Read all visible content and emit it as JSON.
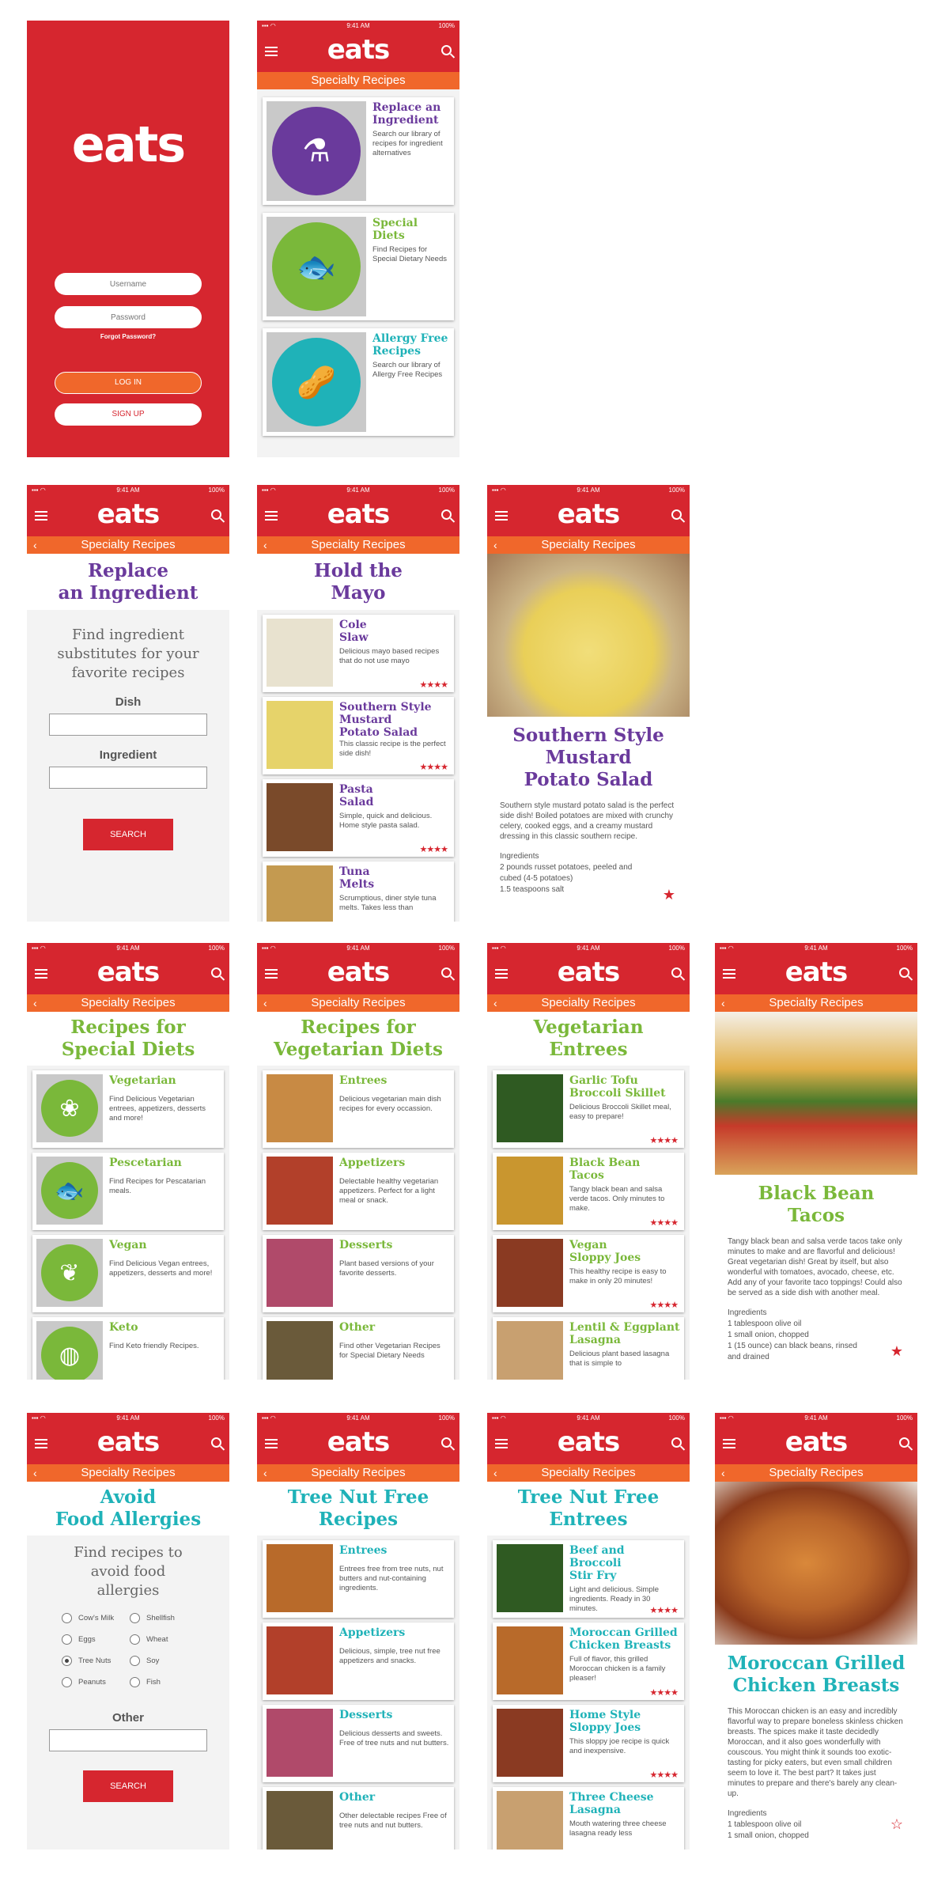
{
  "status": {
    "time": "9:41 AM",
    "battery": "100%"
  },
  "logo": "eats",
  "subheader": "Specialty Recipes",
  "icons": {
    "menu": "hamburger-icon",
    "search": "search-icon",
    "back": "chevron-left-icon",
    "star": "star-icon"
  },
  "colors": {
    "red": "#d6262f",
    "orange": "#f0672b",
    "purple": "#6a3a9c",
    "green": "#7ab83a",
    "teal": "#1fb2b8"
  },
  "login": {
    "username_placeholder": "Username",
    "password_placeholder": "Password",
    "forgot": "Forgot Password?",
    "login": "LOG IN",
    "signup": "SIGN UP"
  },
  "home": {
    "cards": [
      {
        "title": "Replace an Ingredient",
        "desc": "Search our library of recipes for ingredient alternatives"
      },
      {
        "title": "Special Diets",
        "desc": "Find Recipes for Special Dietary Needs"
      },
      {
        "title": "Allergy Free Recipes",
        "desc": "Search our library of Allergy Free Recipes"
      }
    ]
  },
  "replace": {
    "title1": "Replace",
    "title2": "an Ingredient",
    "intro": "Find ingredient substitutes for your favorite recipes",
    "dish_label": "Dish",
    "ingredient_label": "Ingredient",
    "search": "SEARCH"
  },
  "mayo": {
    "title1": "Hold the",
    "title2": "Mayo",
    "items": [
      {
        "t1": "Cole",
        "t2": "Slaw",
        "t3": "",
        "desc": "Delicious mayo based recipes that do not use mayo",
        "stars": "★★★★"
      },
      {
        "t1": "Southern Style",
        "t2": "Mustard",
        "t3": "Potato Salad",
        "desc": "This classic recipe is the perfect side dish!",
        "stars": "★★★★"
      },
      {
        "t1": "Pasta",
        "t2": "Salad",
        "t3": "",
        "desc": "Simple, quick and delicious. Home style pasta salad.",
        "stars": "★★★★"
      },
      {
        "t1": "Tuna",
        "t2": "Melts",
        "t3": "",
        "desc": "Scrumptious, diner style tuna melts. Takes less than",
        "stars": ""
      }
    ]
  },
  "potato": {
    "title1": "Southern Style",
    "title2": "Mustard",
    "title3": "Potato Salad",
    "desc": "Southern style mustard potato salad is the perfect side dish! Boiled potatoes are mixed with crunchy celery, cooked eggs, and a creamy mustard dressing in this classic southern recipe.",
    "ing_label": "Ingredients",
    "ing": [
      "2 pounds russet potatoes, peeled and cubed (4-5 potatoes)",
      "1.5 teaspoons salt"
    ]
  },
  "special": {
    "title1": "Recipes for",
    "title2": "Special Diets",
    "items": [
      {
        "t": "Vegetarian",
        "d": "Find Delicious Vegetarian entrees, appetizers, desserts and more!"
      },
      {
        "t": "Pescetarian",
        "d": "Find Recipes for Pescatarian meals."
      },
      {
        "t": "Vegan",
        "d": "Find Delicious Vegan entrees, appetizers, desserts and more!"
      },
      {
        "t": "Keto",
        "d": "Find Keto friendly Recipes."
      }
    ]
  },
  "vegdiet": {
    "title1": "Recipes for",
    "title2": "Vegetarian Diets",
    "items": [
      {
        "t": "Entrees",
        "d": "Delicious vegetarian main dish recipes for every occassion."
      },
      {
        "t": "Appetizers",
        "d": "Delectable healthy vegetarian appetizers. Perfect for a light meal or snack."
      },
      {
        "t": "Desserts",
        "d": "Plant based versions of your favorite desserts."
      },
      {
        "t": "Other",
        "d": "Find other Vegetarian Recipes for Special Dietary Needs"
      }
    ]
  },
  "vegent": {
    "title1": "Vegetarian",
    "title2": "Entrees",
    "items": [
      {
        "t1": "Garlic Tofu",
        "t2": "Broccoli Skillet",
        "d": "Delicious Broccoli Skillet meal, easy to prepare!",
        "stars": "★★★★"
      },
      {
        "t1": "Black Bean",
        "t2": "Tacos",
        "d": "Tangy black bean and salsa verde tacos. Only minutes to make.",
        "stars": "★★★★"
      },
      {
        "t1": "Vegan",
        "t2": "Sloppy Joes",
        "d": "This healthy recipe is easy to make in only 20 minutes!",
        "stars": "★★★★"
      },
      {
        "t1": "Lentil & Eggplant",
        "t2": "Lasagna",
        "d": "Delicious plant based lasagna that is simple to",
        "stars": ""
      }
    ]
  },
  "tacos": {
    "title1": "Black Bean",
    "title2": "Tacos",
    "desc": "Tangy black bean and salsa verde tacos take only minutes to make and are flavorful and delicious! Great vegetarian dish! Great by itself, but also wonderful with tomatoes, avocado, cheese, etc. Add any of your favorite taco toppings! Could also be served as a side dish with another meal.",
    "ing_label": "Ingredients",
    "ing": [
      "1 tablespoon olive oil",
      "1 small onion, chopped",
      "1 (15 ounce) can black beans, rinsed",
      "and drained"
    ]
  },
  "allergy": {
    "title1": "Avoid",
    "title2": "Food Allergies",
    "intro": "Find recipes to avoid food allergies",
    "opts": [
      "Cow's Milk",
      "Shellfish",
      "Eggs",
      "Wheat",
      "Tree Nuts",
      "Soy",
      "Peanuts",
      "Fish"
    ],
    "other": "Other",
    "search": "SEARCH"
  },
  "treenut": {
    "title1": "Tree Nut Free",
    "title2": "Recipes",
    "items": [
      {
        "t": "Entrees",
        "d": "Entrees free from tree nuts, nut butters and nut-containing ingredients."
      },
      {
        "t": "Appetizers",
        "d": "Delicious, simple, tree nut free appetizers and snacks."
      },
      {
        "t": "Desserts",
        "d": "Delicious desserts and sweets. Free of tree nuts and nut butters."
      },
      {
        "t": "Other",
        "d": "Other delectable recipes Free of tree nuts and nut butters."
      }
    ]
  },
  "tnent": {
    "title1": "Tree Nut Free",
    "title2": "Entrees",
    "items": [
      {
        "t1": "Beef and Broccoli",
        "t2": "Stir Fry",
        "d": "Light and delicious. Simple ingredients. Ready in 30 minutes.",
        "stars": "★★★★"
      },
      {
        "t1": "Moroccan Grilled",
        "t2": "Chicken Breasts",
        "d": "Full of flavor, this grilled Moroccan chicken is a family pleaser!",
        "stars": "★★★★"
      },
      {
        "t1": "Home Style",
        "t2": "Sloppy Joes",
        "d": "This sloppy joe recipe is quick and inexpensive.",
        "stars": "★★★★"
      },
      {
        "t1": "Three Cheese",
        "t2": "Lasagna",
        "d": "Mouth watering three cheese lasagna ready less",
        "stars": ""
      }
    ]
  },
  "moroccan": {
    "title1": "Moroccan Grilled",
    "title2": "Chicken Breasts",
    "desc": "This Moroccan chicken is an easy and incredibly flavorful way to prepare boneless skinless chicken breasts. The spices make it taste decidedly Moroccan, and it also goes wonderfully with couscous. You might think it sounds too exotic-tasting for picky eaters, but even small children seem to love it. The best part? It takes just minutes to prepare and there's barely any clean-up.",
    "ing_label": "Ingredients",
    "ing": [
      "1 tablespoon olive oil",
      "1 small onion, chopped"
    ]
  }
}
